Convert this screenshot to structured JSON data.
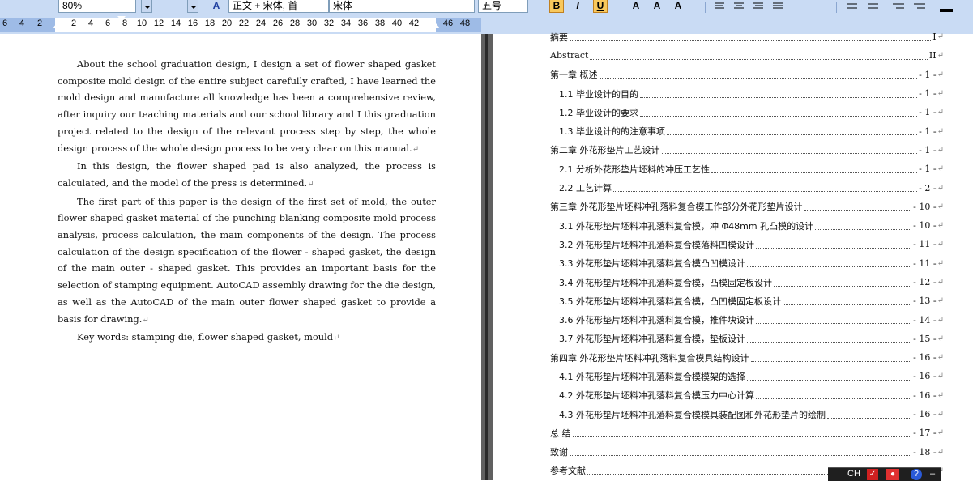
{
  "toolbar": {
    "zoom_value": "80%",
    "style_value": "正文 + 宋体, 首",
    "font_value": "宋体",
    "size_value": "五号",
    "bold_label": "B",
    "italic_label": "I",
    "underline_label": "U"
  },
  "ruler": {
    "numbers": [
      "6",
      "4",
      "2",
      "2",
      "4",
      "6",
      "8",
      "10",
      "12",
      "14",
      "16",
      "18",
      "20",
      "22",
      "24",
      "26",
      "28",
      "30",
      "32",
      "34",
      "36",
      "38",
      "40",
      "42",
      "46",
      "48"
    ]
  },
  "abstract": {
    "paragraphs": [
      "About the school graduation design, I design a set of flower shaped gasket composite mold design of the entire subject carefully crafted, I have learned the mold design and manufacture all knowledge has been a comprehensive review, after inquiry our teaching materials and our school library and I this graduation project related to the design of the relevant process step by step, the whole design process of the whole design process to be very clear on this manual.",
      "In this design, the flower shaped pad is also analyzed, the process is calculated, and the model of the press is determined.",
      "The first part of this paper is the design of the first set of mold, the outer flower shaped gasket material of the punching blanking composite mold process analysis, process calculation, the main components of the design. The process calculation of the design specification of the flower - shaped gasket, the design of the main outer - shaped gasket. This provides an important basis for the selection of stamping equipment. AutoCAD assembly drawing for the die design, as well as the AutoCAD of the main outer flower shaped gasket to provide a basis for drawing.",
      "Key words: stamping die, flower shaped gasket, mould"
    ]
  },
  "toc": {
    "entries": [
      {
        "text": "摘要",
        "page": "I",
        "level": 0
      },
      {
        "text": "Abstract",
        "page": "II",
        "level": 0
      },
      {
        "text": "第一章  概述",
        "page": "- 1 -",
        "level": 0
      },
      {
        "text": "1.1 毕业设计的目的",
        "page": "- 1 -",
        "level": 1
      },
      {
        "text": "1.2  毕业设计的要求",
        "page": "- 1 -",
        "level": 1
      },
      {
        "text": "1.3 毕业设计的的注意事项",
        "page": "- 1 -",
        "level": 1
      },
      {
        "text": "第二章  外花形垫片工艺设计",
        "page": "- 1 -",
        "level": 0
      },
      {
        "text": "2.1  分析外花形垫片坯料的冲压工艺性",
        "page": "- 1 -",
        "level": 1
      },
      {
        "text": "2.2 工艺计算",
        "page": "- 2 -",
        "level": 1
      },
      {
        "text": "第三章  外花形垫片坯料冲孔落料复合模工作部分外花形垫片设计",
        "page": "- 10 -",
        "level": 0
      },
      {
        "text": "3.1 外花形垫片坯料冲孔落料复合模，冲 Φ48mm 孔凸模的设计",
        "page": "- 10 -",
        "level": 1
      },
      {
        "text": "3.2 外花形垫片坯料冲孔落料复合模落料凹模设计",
        "page": "- 11 -",
        "level": 1
      },
      {
        "text": "3.3 外花形垫片坯料冲孔落料复合模凸凹模设计",
        "page": "- 11 -",
        "level": 1
      },
      {
        "text": "3.4  外花形垫片坯料冲孔落料复合模，凸模固定板设计",
        "page": "- 12 -",
        "level": 1
      },
      {
        "text": "3.5 外花形垫片坯料冲孔落料复合模，凸凹模固定板设计",
        "page": "- 13 -",
        "level": 1
      },
      {
        "text": "3.6  外花形垫片坯料冲孔落料复合模，推件块设计",
        "page": "- 14 -",
        "level": 1
      },
      {
        "text": "3.7 外花形垫片坯料冲孔落料复合模，垫板设计",
        "page": "- 15 -",
        "level": 1
      },
      {
        "text": "第四章  外花形垫片坯料冲孔落料复合模具结构设计",
        "page": "- 16 -",
        "level": 0
      },
      {
        "text": "4.1 外花形垫片坯料冲孔落料复合模模架的选择",
        "page": "- 16 -",
        "level": 1
      },
      {
        "text": "4.2  外花形垫片坯料冲孔落料复合模压力中心计算",
        "page": "- 16 -",
        "level": 1
      },
      {
        "text": "4.3 外花形垫片坯料冲孔落料复合模模具装配图和外花形垫片的绘制",
        "page": "- 16 -",
        "level": 1
      },
      {
        "text": "总    结",
        "page": "- 17 -",
        "level": 0
      },
      {
        "text": "致谢",
        "page": "- 18 -",
        "level": 0
      },
      {
        "text": "参考文献",
        "page": "",
        "level": 0
      }
    ]
  },
  "taskbar": {
    "ime_label": "CH",
    "help_label": "?"
  }
}
